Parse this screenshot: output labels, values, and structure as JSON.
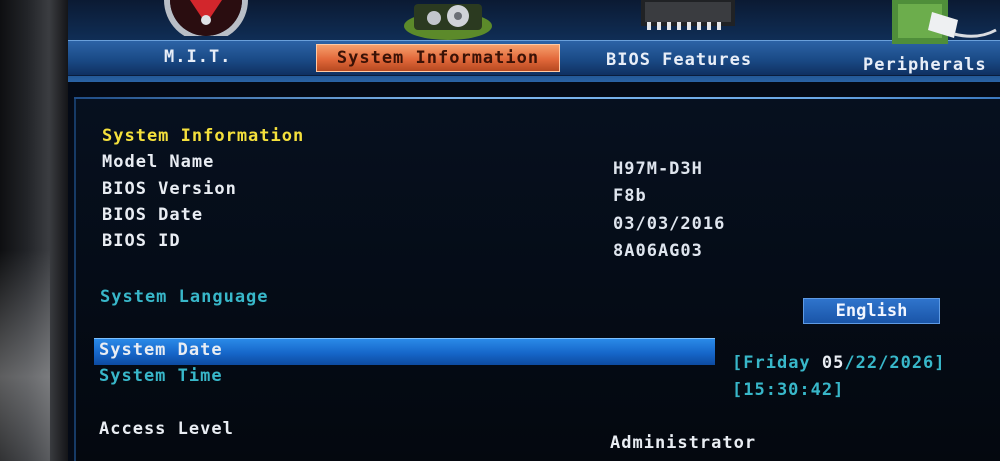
{
  "tabs": {
    "mit": "M.I.T.",
    "system_information": "System Information",
    "bios_features": "BIOS Features",
    "peripherals": "Peripherals"
  },
  "section": {
    "title": "System Information"
  },
  "info": {
    "model_name_label": "Model Name",
    "model_name_value": "H97M-D3H",
    "bios_version_label": "BIOS Version",
    "bios_version_value": "F8b",
    "bios_date_label": "BIOS Date",
    "bios_date_value": "03/03/2016",
    "bios_id_label": "BIOS ID",
    "bios_id_value": "8A06AG03"
  },
  "language": {
    "label": "System Language",
    "value": "English"
  },
  "date": {
    "label": "System Date",
    "open": "[",
    "weekday": "Friday",
    "month": "05",
    "rest": "/22/2026",
    "close": "]"
  },
  "time": {
    "label": "System Time",
    "value": "[15:30:42]"
  },
  "access": {
    "label": "Access Level",
    "value": "Administrator"
  },
  "colors": {
    "section_title": "#f4e03c",
    "selectable_label": "#38b7c9",
    "active_tab": "#e2683a",
    "highlight": "#1666c9"
  }
}
